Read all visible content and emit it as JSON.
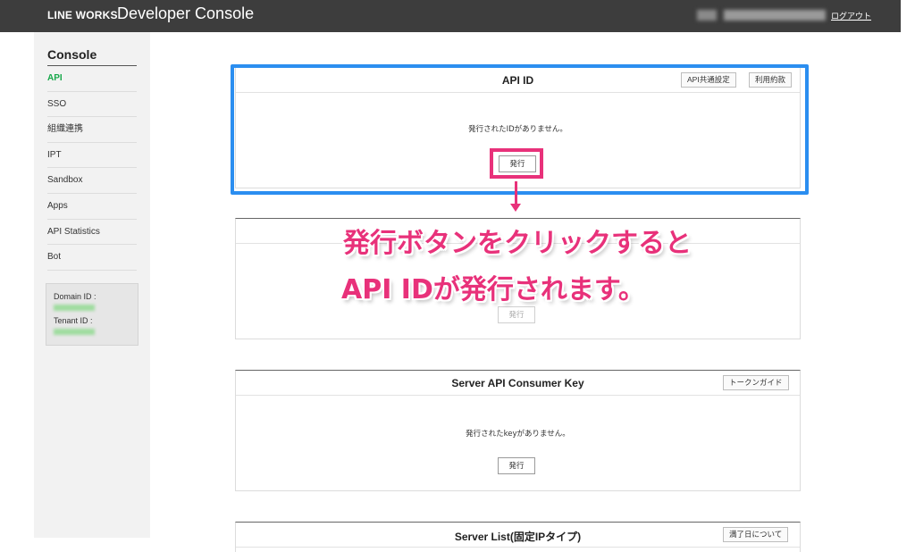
{
  "header": {
    "logo": "LINE WORKS",
    "title": "Developer Console",
    "logout": "ログアウト"
  },
  "sidebar": {
    "heading": "Console",
    "items": [
      {
        "label": "API",
        "active": true
      },
      {
        "label": "SSO"
      },
      {
        "label": "組織連携"
      },
      {
        "label": "IPT"
      },
      {
        "label": "Sandbox"
      },
      {
        "label": "Apps"
      },
      {
        "label": "API Statistics"
      },
      {
        "label": "Bot"
      }
    ],
    "domain_label": "Domain ID :",
    "tenant_label": "Tenant ID :"
  },
  "panels": {
    "api_id": {
      "title": "API ID",
      "btn_common": "API共通設定",
      "btn_terms": "利用約款",
      "empty": "発行されたIDがありません。",
      "issue": "発行"
    },
    "second": {
      "issue": "発行"
    },
    "consumer_key": {
      "title": "Server API Consumer Key",
      "btn_guide": "トークンガイド",
      "empty": "発行されたkeyがありません。",
      "issue": "発行"
    },
    "server_list": {
      "title": "Server List(固定IPタイプ)",
      "btn_expiry": "満了日について"
    }
  },
  "annotation": {
    "line1": "発行ボタンをクリックすると",
    "line2": "API IDが発行されます。"
  },
  "colors": {
    "header_bg": "#3d3d3d",
    "active_nav": "#17a84a",
    "highlight_blue": "#2b8ef0",
    "highlight_pink": "#e8317a"
  }
}
